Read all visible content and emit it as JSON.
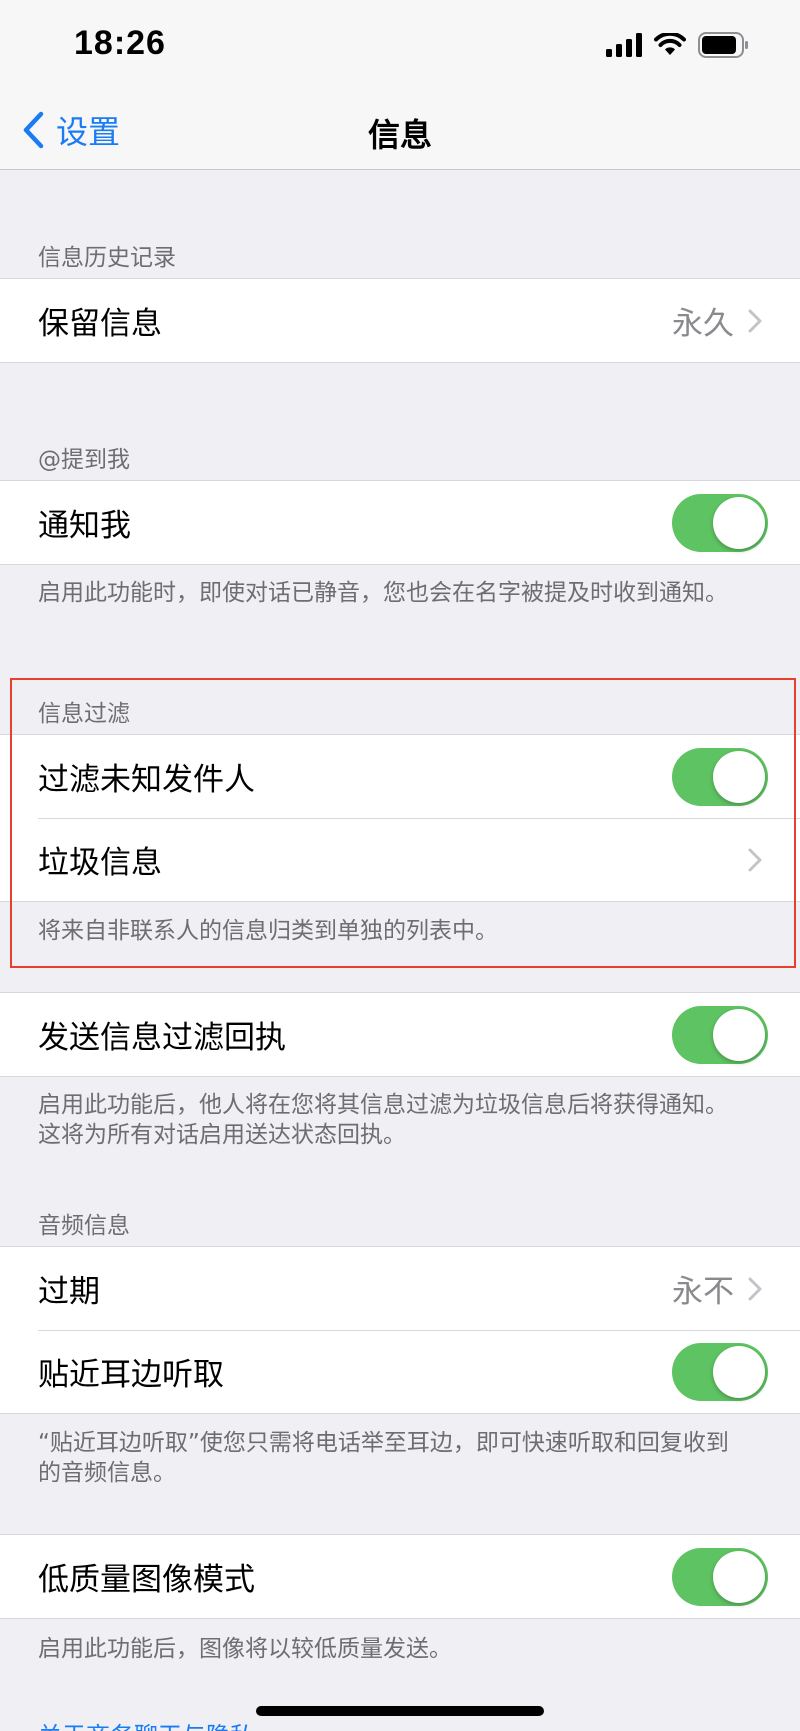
{
  "status_bar": {
    "time": "18:26"
  },
  "nav": {
    "back_label": "设置",
    "title": "信息"
  },
  "sections": {
    "history": {
      "header": "信息历史记录",
      "keep_messages": {
        "label": "保留信息",
        "value": "永久"
      }
    },
    "mentions": {
      "header": "@提到我",
      "notify_me": {
        "label": "通知我",
        "on": true
      },
      "footnote": "启用此功能时，即使对话已静音，您也会在名字被提及时收到通知。"
    },
    "filtering": {
      "header": "信息过滤",
      "filter_unknown": {
        "label": "过滤未知发件人",
        "on": true
      },
      "junk": {
        "label": "垃圾信息"
      },
      "footnote": "将来自非联系人的信息归类到单独的列表中。"
    },
    "receipts": {
      "send_receipts": {
        "label": "发送信息过滤回执",
        "on": true
      },
      "footnote": "启用此功能后，他人将在您将其信息过滤为垃圾信息后将获得通知。这将为所有对话启用送达状态回执。"
    },
    "audio": {
      "header": "音频信息",
      "expire": {
        "label": "过期",
        "value": "永不"
      },
      "raise_to_listen": {
        "label": "贴近耳边听取",
        "on": true
      },
      "footnote": "“贴近耳边听取”使您只需将电话举至耳边，即可快速听取和回复收到的音频信息。"
    },
    "low_quality": {
      "low_quality_mode": {
        "label": "低质量图像模式",
        "on": true
      },
      "footnote": "启用此功能后，图像将以较低质量发送。"
    }
  },
  "bottom_link": "关于商务聊天与隐私",
  "colors": {
    "accent": "#1a7cf5",
    "toggle_on": "#5ec362",
    "highlight": "#e8402f"
  }
}
